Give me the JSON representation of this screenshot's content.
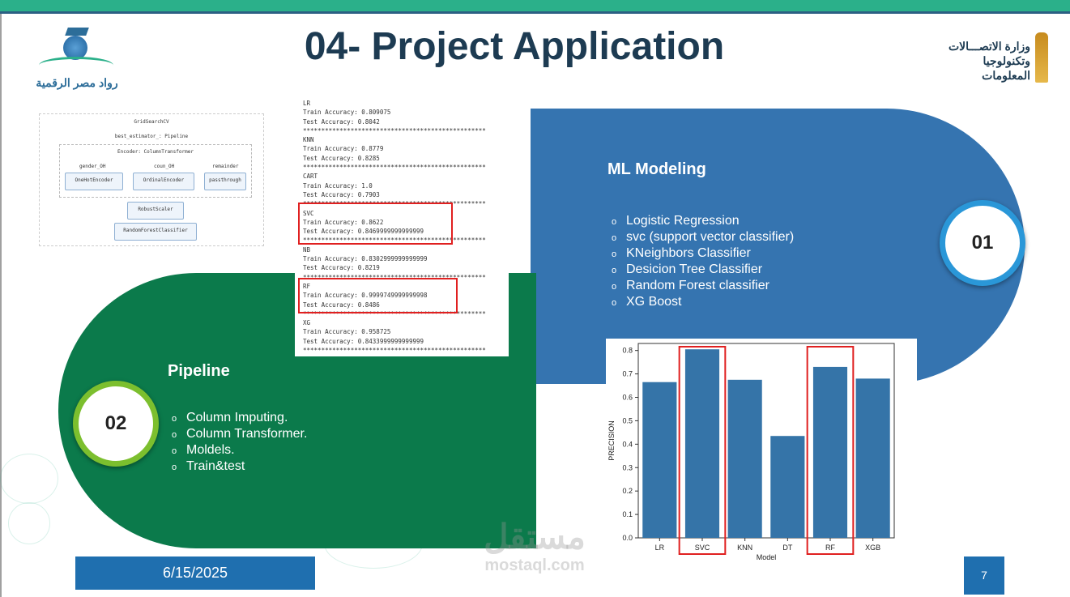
{
  "slide": {
    "title": "04- Project Application",
    "logo_left_text": "رواد مصر الرقمية",
    "logo_right_text_1": "وزارة الاتصـــالات",
    "logo_right_text_2": "وتكنولوجيا المعلومات",
    "date": "6/15/2025",
    "page_number": "7",
    "watermark_1": "مستقل",
    "watermark_2": "mostaql.com"
  },
  "ml_section": {
    "number": "01",
    "heading": "ML Modeling",
    "items": [
      "Logistic Regression",
      "svc (support vector classifier)",
      "KNeighbors Classifier",
      "Desicion Tree Classifier",
      "Random Forest classifier",
      "XG Boost"
    ]
  },
  "pipeline_section": {
    "number": "02",
    "heading": "Pipeline",
    "items": [
      "Column Imputing.",
      "Column Transformer.",
      "Moldels.",
      "Train&test"
    ]
  },
  "pipeline_diagram": {
    "root": "GridSearchCV",
    "estimator": "best_estimator_: Pipeline",
    "encoder": "Encoder: ColumnTransformer",
    "col1": "gender_OH",
    "col2": "coun_OH",
    "col3": "remainder",
    "box1": "OneHotEncoder",
    "box2": "OrdinalEncoder",
    "box3": "passthrough",
    "scaler": "RobustScaler",
    "model": "RandomForestClassifier"
  },
  "results_output": {
    "lines": [
      "LR",
      "Train Accuracy: 0.809075",
      "Test Accuracy: 0.8042",
      "**************************************************",
      "KNN",
      "Train Accuracy: 0.8779",
      "Test Accuracy: 0.8285",
      "**************************************************",
      "CART",
      "Train Accuracy: 1.0",
      "Test Accuracy: 0.7903",
      "**************************************************",
      "SVC",
      "Train Accuracy: 0.8622",
      "Test Accuracy: 0.8469999999999999",
      "**************************************************",
      "NB",
      "Train Accuracy: 0.8302999999999999",
      "Test Accuracy: 0.8219",
      "**************************************************",
      "RF",
      "Train Accuracy: 0.9999749999999998",
      "Test Accuracy: 0.8486",
      "**************************************************",
      "XG",
      "Train Accuracy: 0.958725",
      "Test Accuracy: 0.8433999999999999",
      "**************************************************"
    ]
  },
  "chart_data": {
    "type": "bar",
    "categories": [
      "LR",
      "SVC",
      "KNN",
      "DT",
      "RF",
      "XGB"
    ],
    "values": [
      0.665,
      0.805,
      0.675,
      0.435,
      0.73,
      0.68
    ],
    "xlabel": "Model",
    "ylabel": "PRECISION",
    "ylim": [
      0,
      0.83
    ],
    "yticks": [
      "0.0",
      "0.1",
      "0.2",
      "0.3",
      "0.4",
      "0.5",
      "0.6",
      "0.7",
      "0.8"
    ],
    "bar_color": "#3574a8",
    "highlighted": [
      "SVC",
      "RF"
    ],
    "highlight_color": "#e02020"
  },
  "colors": {
    "ml_blue": "#3574b0",
    "pipeline_green": "#0b7a4b",
    "title_navy": "#1d3b52"
  }
}
